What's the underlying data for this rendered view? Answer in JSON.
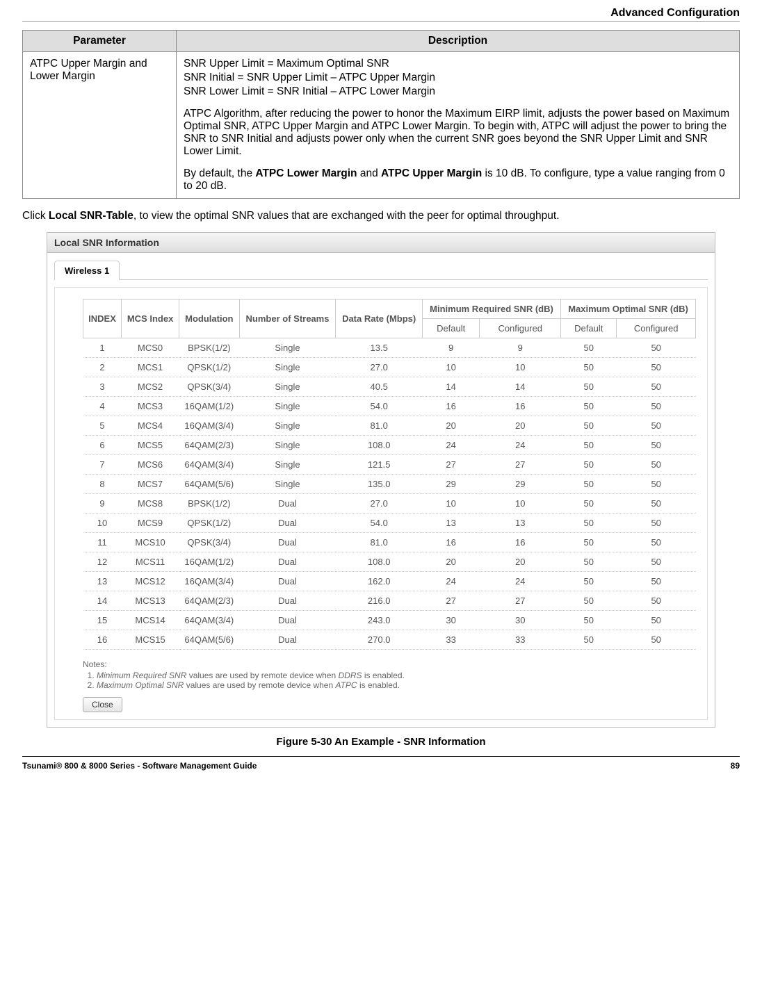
{
  "header": {
    "section_title": "Advanced Configuration"
  },
  "param_table": {
    "headers": {
      "param": "Parameter",
      "desc": "Description"
    },
    "row": {
      "param": "ATPC Upper Margin and Lower Margin",
      "line1": "SNR Upper Limit = Maximum Optimal SNR",
      "line2": "SNR Initial = SNR Upper Limit – ATPC Upper Margin",
      "line3": "SNR Lower Limit = SNR Initial – ATPC Lower Margin",
      "para1": "ATPC Algorithm, after reducing the power to honor the Maximum EIRP limit, adjusts the power based on Maximum Optimal SNR, ATPC Upper Margin and ATPC Lower Margin. To begin with, ATPC will adjust the power to bring the SNR to SNR Initial and adjusts power only when the current SNR goes beyond the SNR Upper Limit and SNR Lower Limit.",
      "para2_pre": "By default, the ",
      "para2_b1": "ATPC Lower Margin",
      "para2_mid": " and ",
      "para2_b2": "ATPC Upper Margin",
      "para2_post": " is 10 dB. To configure, type a value ranging from 0 to 20 dB."
    }
  },
  "instruction": {
    "pre": "Click ",
    "bold": "Local SNR-Table",
    "post": ", to view the optimal SNR values that are exchanged with the peer for optimal throughput."
  },
  "modal": {
    "title": "Local SNR Information",
    "tab1": "Wireless 1",
    "headers": {
      "index": "INDEX",
      "mcs_index": "MCS Index",
      "modulation": "Modulation",
      "streams": "Number of Streams",
      "data_rate": "Data Rate (Mbps)",
      "min_snr": "Minimum Required SNR (dB)",
      "max_snr": "Maximum Optimal SNR (dB)",
      "default": "Default",
      "configured": "Configured"
    },
    "rows": [
      {
        "index": "1",
        "mcs": "MCS0",
        "mod": "BPSK(1/2)",
        "str": "Single",
        "rate": "13.5",
        "min_d": "9",
        "min_c": "9",
        "max_d": "50",
        "max_c": "50"
      },
      {
        "index": "2",
        "mcs": "MCS1",
        "mod": "QPSK(1/2)",
        "str": "Single",
        "rate": "27.0",
        "min_d": "10",
        "min_c": "10",
        "max_d": "50",
        "max_c": "50"
      },
      {
        "index": "3",
        "mcs": "MCS2",
        "mod": "QPSK(3/4)",
        "str": "Single",
        "rate": "40.5",
        "min_d": "14",
        "min_c": "14",
        "max_d": "50",
        "max_c": "50"
      },
      {
        "index": "4",
        "mcs": "MCS3",
        "mod": "16QAM(1/2)",
        "str": "Single",
        "rate": "54.0",
        "min_d": "16",
        "min_c": "16",
        "max_d": "50",
        "max_c": "50"
      },
      {
        "index": "5",
        "mcs": "MCS4",
        "mod": "16QAM(3/4)",
        "str": "Single",
        "rate": "81.0",
        "min_d": "20",
        "min_c": "20",
        "max_d": "50",
        "max_c": "50"
      },
      {
        "index": "6",
        "mcs": "MCS5",
        "mod": "64QAM(2/3)",
        "str": "Single",
        "rate": "108.0",
        "min_d": "24",
        "min_c": "24",
        "max_d": "50",
        "max_c": "50"
      },
      {
        "index": "7",
        "mcs": "MCS6",
        "mod": "64QAM(3/4)",
        "str": "Single",
        "rate": "121.5",
        "min_d": "27",
        "min_c": "27",
        "max_d": "50",
        "max_c": "50"
      },
      {
        "index": "8",
        "mcs": "MCS7",
        "mod": "64QAM(5/6)",
        "str": "Single",
        "rate": "135.0",
        "min_d": "29",
        "min_c": "29",
        "max_d": "50",
        "max_c": "50"
      },
      {
        "index": "9",
        "mcs": "MCS8",
        "mod": "BPSK(1/2)",
        "str": "Dual",
        "rate": "27.0",
        "min_d": "10",
        "min_c": "10",
        "max_d": "50",
        "max_c": "50"
      },
      {
        "index": "10",
        "mcs": "MCS9",
        "mod": "QPSK(1/2)",
        "str": "Dual",
        "rate": "54.0",
        "min_d": "13",
        "min_c": "13",
        "max_d": "50",
        "max_c": "50"
      },
      {
        "index": "11",
        "mcs": "MCS10",
        "mod": "QPSK(3/4)",
        "str": "Dual",
        "rate": "81.0",
        "min_d": "16",
        "min_c": "16",
        "max_d": "50",
        "max_c": "50"
      },
      {
        "index": "12",
        "mcs": "MCS11",
        "mod": "16QAM(1/2)",
        "str": "Dual",
        "rate": "108.0",
        "min_d": "20",
        "min_c": "20",
        "max_d": "50",
        "max_c": "50"
      },
      {
        "index": "13",
        "mcs": "MCS12",
        "mod": "16QAM(3/4)",
        "str": "Dual",
        "rate": "162.0",
        "min_d": "24",
        "min_c": "24",
        "max_d": "50",
        "max_c": "50"
      },
      {
        "index": "14",
        "mcs": "MCS13",
        "mod": "64QAM(2/3)",
        "str": "Dual",
        "rate": "216.0",
        "min_d": "27",
        "min_c": "27",
        "max_d": "50",
        "max_c": "50"
      },
      {
        "index": "15",
        "mcs": "MCS14",
        "mod": "64QAM(3/4)",
        "str": "Dual",
        "rate": "243.0",
        "min_d": "30",
        "min_c": "30",
        "max_d": "50",
        "max_c": "50"
      },
      {
        "index": "16",
        "mcs": "MCS15",
        "mod": "64QAM(5/6)",
        "str": "Dual",
        "rate": "270.0",
        "min_d": "33",
        "min_c": "33",
        "max_d": "50",
        "max_c": "50"
      }
    ],
    "notes": {
      "title": "Notes:",
      "n1_a": "Minimum Required SNR",
      "n1_b": " values are used by remote device when ",
      "n1_c": "DDRS",
      "n1_d": " is enabled.",
      "n2_a": "Maximum Optimal SNR",
      "n2_b": " values are used by remote device when ",
      "n2_c": "ATPC",
      "n2_d": " is enabled."
    },
    "close": "Close"
  },
  "figure_caption": "Figure 5-30 An Example - SNR Information",
  "footer": {
    "left": "Tsunami® 800 & 8000 Series - Software Management Guide",
    "right": "89"
  }
}
